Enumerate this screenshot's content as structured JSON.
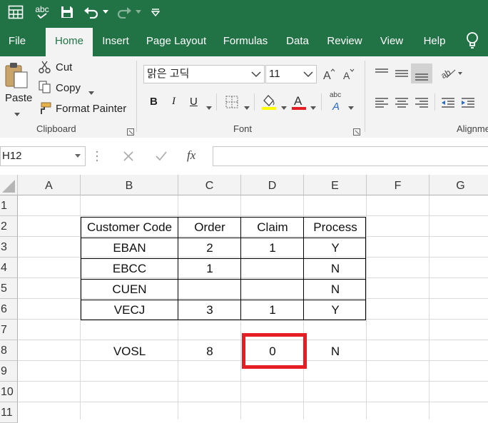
{
  "colors": {
    "brand": "#217346",
    "highlight": "#e51e25"
  },
  "quick_access": {
    "icons": [
      "layout-icon",
      "spellcheck-icon",
      "save-icon",
      "undo-icon",
      "redo-icon",
      "customize-icon"
    ],
    "spell_label": "abc"
  },
  "tabs": [
    "File",
    "Home",
    "Insert",
    "Page Layout",
    "Formulas",
    "Data",
    "Review",
    "View",
    "Help"
  ],
  "active_tab": "Home",
  "ribbon": {
    "clipboard": {
      "paste": "Paste",
      "cut": "Cut",
      "copy": "Copy",
      "format_painter": "Format Painter",
      "label": "Clipboard"
    },
    "font": {
      "name": "맑은 고딕",
      "size": "11",
      "bold": "B",
      "italic": "I",
      "underline": "U",
      "label": "Font",
      "font_color_letter": "A",
      "phonetic": "abc"
    },
    "alignment": {
      "label": "Alignme"
    }
  },
  "formula_bar": {
    "name_box": "H12",
    "fx": "fx",
    "formula": ""
  },
  "grid": {
    "columns": [
      "A",
      "B",
      "C",
      "D",
      "E",
      "F",
      "G"
    ],
    "rows": [
      "1",
      "2",
      "3",
      "4",
      "5",
      "6",
      "7",
      "8",
      "9",
      "10",
      "11"
    ],
    "table_header": [
      "Customer Code",
      "Order",
      "Claim",
      "Process"
    ],
    "table_rows": [
      [
        "EBAN",
        "2",
        "1",
        "Y"
      ],
      [
        "EBCC",
        "1",
        "",
        "N"
      ],
      [
        "CUEN",
        "",
        "",
        "N"
      ],
      [
        "VECJ",
        "3",
        "1",
        "Y"
      ]
    ],
    "row8": [
      "VOSL",
      "8",
      "0",
      "N"
    ]
  }
}
